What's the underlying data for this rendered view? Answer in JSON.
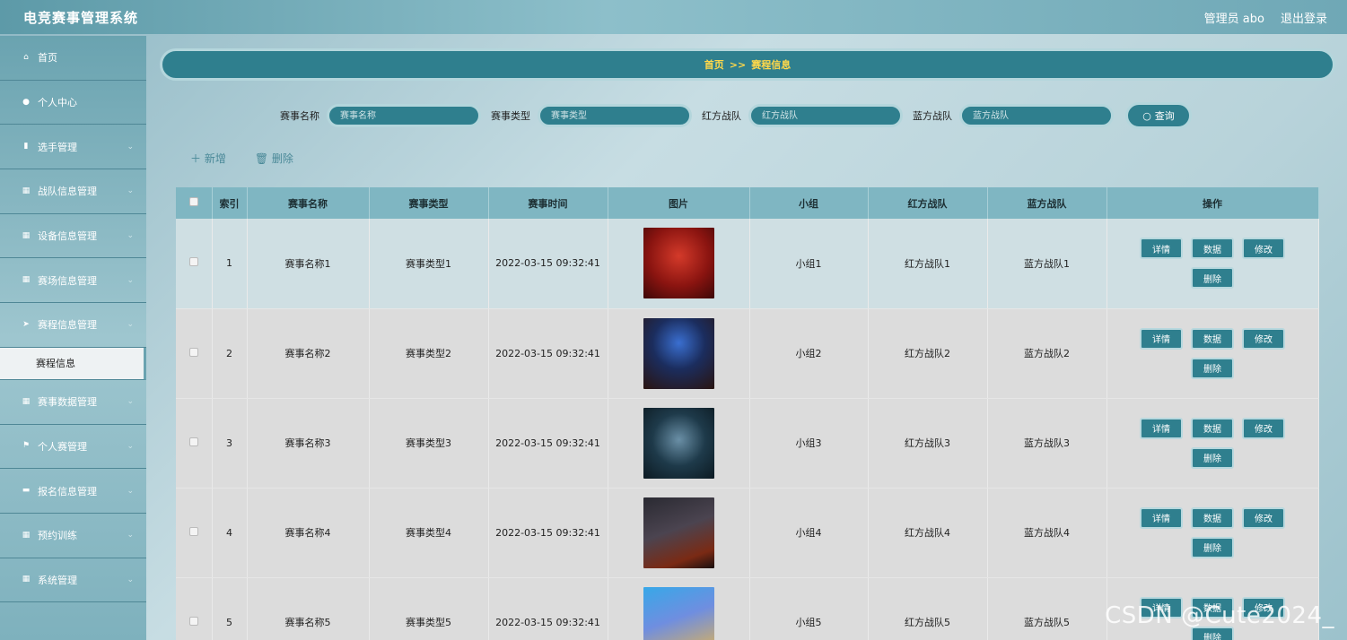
{
  "app": {
    "title": "电竞赛事管理系统",
    "user": "管理员 abo",
    "logout": "退出登录"
  },
  "sidebar": {
    "items": [
      {
        "label": "首页",
        "icon": "home-icon"
      },
      {
        "label": "个人中心",
        "icon": "user-icon"
      },
      {
        "label": "选手管理",
        "icon": "clipboard-icon"
      },
      {
        "label": "战队信息管理",
        "icon": "grid-icon"
      },
      {
        "label": "设备信息管理",
        "icon": "grid-icon"
      },
      {
        "label": "赛场信息管理",
        "icon": "grid9-icon"
      },
      {
        "label": "赛程信息管理",
        "icon": "send-icon"
      },
      {
        "label": "赛事数据管理",
        "icon": "grid-icon"
      },
      {
        "label": "个人赛管理",
        "icon": "flag-icon"
      },
      {
        "label": "报名信息管理",
        "icon": "briefcase-icon"
      },
      {
        "label": "预约训练",
        "icon": "grid-icon"
      },
      {
        "label": "系统管理",
        "icon": "grid-icon"
      }
    ],
    "sub_item": "赛程信息"
  },
  "breadcrumb": {
    "home": "首页",
    "sep": ">>",
    "current": "赛程信息"
  },
  "search": {
    "fields": [
      {
        "label": "赛事名称",
        "placeholder": "赛事名称"
      },
      {
        "label": "赛事类型",
        "placeholder": "赛事类型"
      },
      {
        "label": "红方战队",
        "placeholder": "红方战队"
      },
      {
        "label": "蓝方战队",
        "placeholder": "蓝方战队"
      }
    ],
    "button": "查询"
  },
  "toolbar": {
    "add": "新增",
    "delete": "删除"
  },
  "table": {
    "headers": [
      "索引",
      "赛事名称",
      "赛事类型",
      "赛事时间",
      "图片",
      "小组",
      "红方战队",
      "蓝方战队",
      "操作"
    ],
    "rows": [
      {
        "index": "1",
        "name": "赛事名称1",
        "type": "赛事类型1",
        "time": "2022-03-15 09:32:41",
        "group": "小组1",
        "red": "红方战队1",
        "blue": "蓝方战队1"
      },
      {
        "index": "2",
        "name": "赛事名称2",
        "type": "赛事类型2",
        "time": "2022-03-15 09:32:41",
        "group": "小组2",
        "red": "红方战队2",
        "blue": "蓝方战队2"
      },
      {
        "index": "3",
        "name": "赛事名称3",
        "type": "赛事类型3",
        "time": "2022-03-15 09:32:41",
        "group": "小组3",
        "red": "红方战队3",
        "blue": "蓝方战队3"
      },
      {
        "index": "4",
        "name": "赛事名称4",
        "type": "赛事类型4",
        "time": "2022-03-15 09:32:41",
        "group": "小组4",
        "red": "红方战队4",
        "blue": "蓝方战队4"
      },
      {
        "index": "5",
        "name": "赛事名称5",
        "type": "赛事类型5",
        "time": "2022-03-15 09:32:41",
        "group": "小组5",
        "red": "红方战队5",
        "blue": "蓝方战队5"
      }
    ],
    "ops": {
      "detail": "详情",
      "data": "数据",
      "edit": "修改",
      "del": "删除"
    }
  },
  "watermark": "CSDN @Cute2024_",
  "colors": {
    "accent": "#2f7f8e",
    "crumb_text": "#ffd84a",
    "header": "#7fb6c2"
  }
}
